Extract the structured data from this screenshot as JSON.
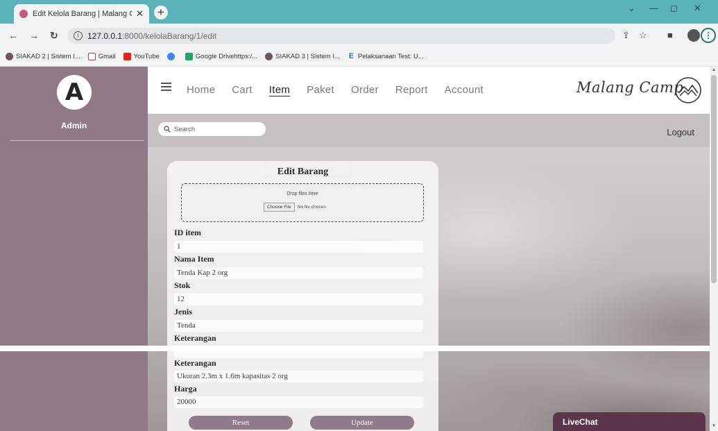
{
  "browser": {
    "tab_title": "Edit Kelola Barang | Malang Ca",
    "tab_close": "✕",
    "new_tab": "+",
    "url_host": "127.0.0.1",
    "url_path": ":8000/kelolaBarang/1/edit",
    "bookmarks": [
      {
        "label": "SIAKAD 2 | Sistem I...",
        "icon": "siakad-icon"
      },
      {
        "label": "Gmail",
        "icon": "gmail-icon"
      },
      {
        "label": "YouTube",
        "icon": "youtube-icon"
      },
      {
        "label": "",
        "icon": "chrome-icon"
      },
      {
        "label": "Google Drivehttps:/...",
        "icon": "drive-icon"
      },
      {
        "label": "SIAKAD 3 | Sistem I...",
        "icon": "siakad-icon"
      },
      {
        "label": "Pelaksanaan Test: U...",
        "icon": "e-icon"
      }
    ]
  },
  "sidebar": {
    "avatar_letter": "A",
    "user_label": "Admin"
  },
  "navbar": {
    "links": [
      "Home",
      "Cart",
      "Item",
      "Paket",
      "Order",
      "Report",
      "Account"
    ],
    "active": "Item",
    "brand": "Malang Camp"
  },
  "toolbar": {
    "search_placeholder": "Search",
    "logout": "Logout"
  },
  "form": {
    "title": "Edit Barang",
    "dropzone_text": "Drop files here",
    "choose_file": "Choose File",
    "no_file": "No file chosen",
    "fields": [
      {
        "label": "ID item",
        "value": "1"
      },
      {
        "label": "Nama Item",
        "value": "Tenda Kap 2 org"
      },
      {
        "label": "Stok",
        "value": "12"
      },
      {
        "label": "Jenis",
        "value": "Tenda"
      },
      {
        "label": "Keterangan",
        "value": ""
      }
    ],
    "fields_lower": [
      {
        "label": "Keterangan",
        "value": "Ukuran 2.3m x 1.6m kapasitas 2 org"
      },
      {
        "label": "Harga",
        "value": "20000"
      }
    ],
    "reset": "Reset",
    "update": "Update"
  },
  "livechat": "LiveChat"
}
